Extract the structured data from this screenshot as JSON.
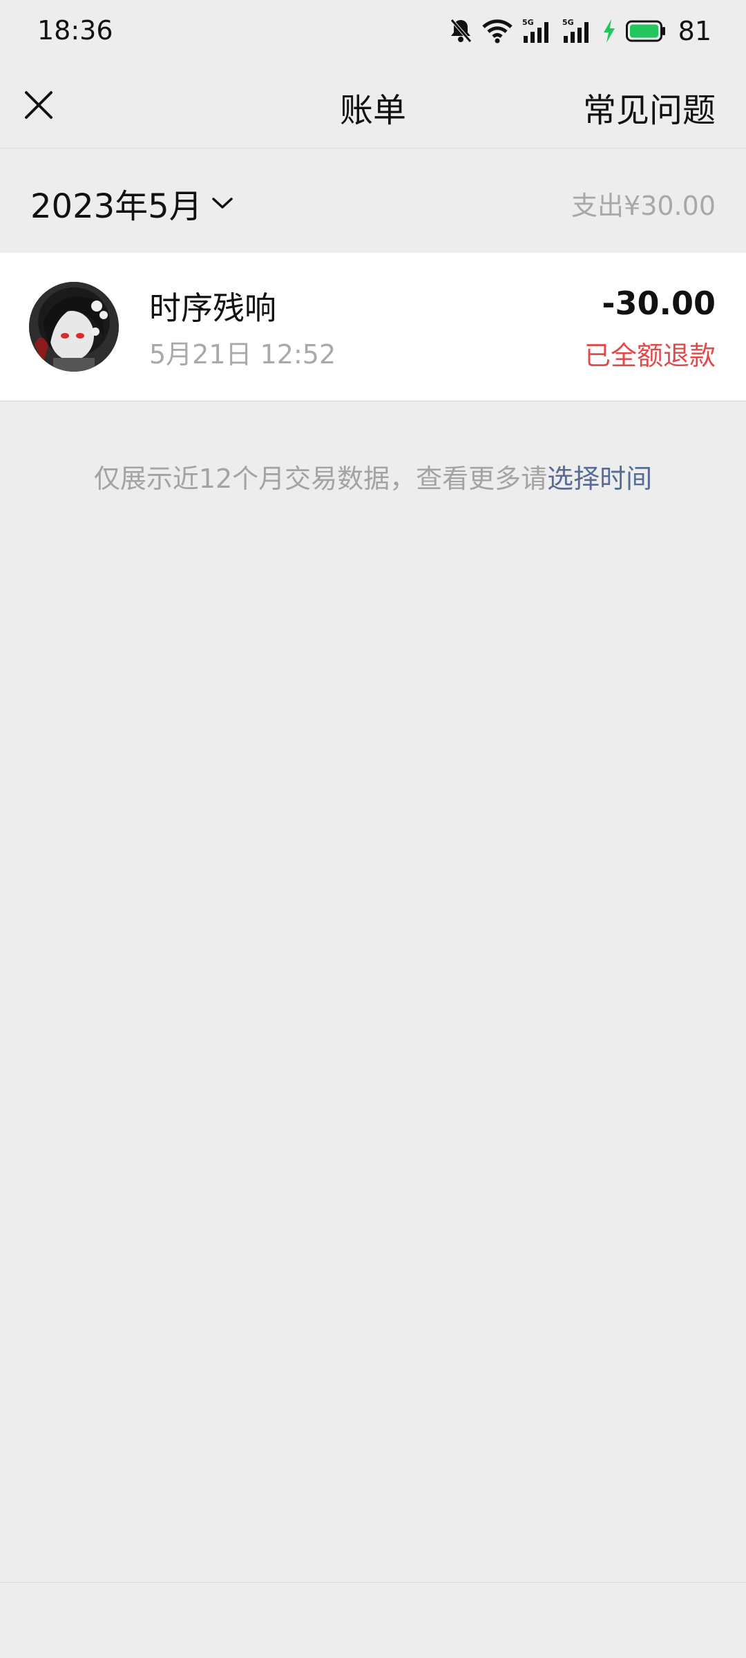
{
  "status_bar": {
    "time": "18:36",
    "battery_percent": "81",
    "icons": [
      "bell-muted-icon",
      "wifi-icon",
      "signal-5g-icon",
      "signal-5g-icon",
      "charging-icon",
      "battery-icon"
    ],
    "signal_label": "5G",
    "battery_color": "#22c55e"
  },
  "nav": {
    "close_icon": "close-icon",
    "title": "账单",
    "faq_label": "常见问题"
  },
  "month_bar": {
    "month_label": "2023年5月",
    "dropdown_icon": "chevron-down-icon",
    "spend_summary": "支出¥30.00"
  },
  "transactions": [
    {
      "name": "时序残响",
      "time": "5月21日 12:52",
      "amount": "-30.00",
      "status": "已全额退款",
      "status_color": "#e24a4a"
    }
  ],
  "footer": {
    "note_text": "仅展示近12个月交易数据，查看更多请",
    "link_text": "选择时间",
    "link_color": "#576b95"
  }
}
